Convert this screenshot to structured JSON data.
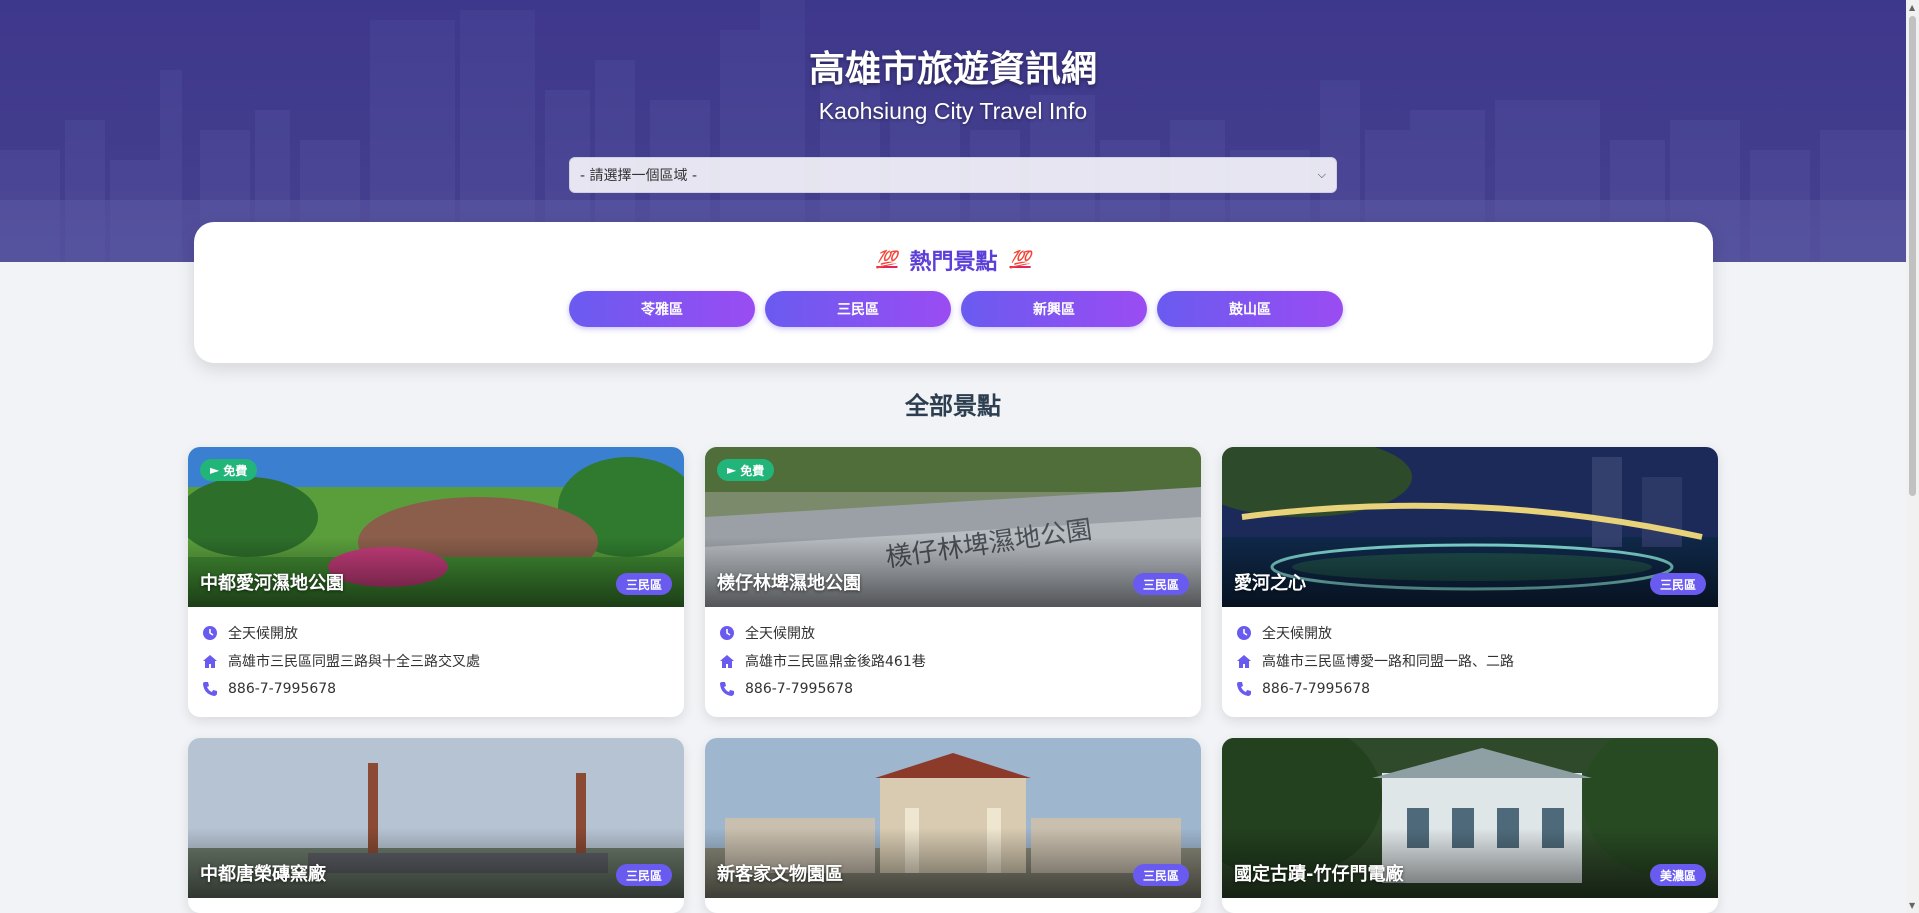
{
  "header": {
    "title": "高雄市旅遊資訊網",
    "subtitle": "Kaohsiung City Travel Info",
    "area_select": {
      "selected": "- 請選擇一個區域 -"
    }
  },
  "hot": {
    "title": "熱門景點",
    "emoji": "💯",
    "buttons": [
      "苓雅區",
      "三民區",
      "新興區",
      "鼓山區"
    ]
  },
  "section": {
    "title": "全部景點"
  },
  "cards": [
    {
      "name": "中都愛河濕地公園",
      "district": "三民區",
      "free": "免費",
      "hours": "全天候開放",
      "address": "高雄市三民區同盟三路與十全三路交叉處",
      "phone": "886-7-7995678"
    },
    {
      "name": "檨仔林埤濕地公園",
      "district": "三民區",
      "free": "免費",
      "hours": "全天候開放",
      "address": "高雄市三民區鼎金後路461巷",
      "phone": "886-7-7995678"
    },
    {
      "name": "愛河之心",
      "district": "三民區",
      "free": "",
      "hours": "全天候開放",
      "address": "高雄市三民區博愛一路和同盟一路、二路",
      "phone": "886-7-7995678"
    },
    {
      "name": "中都唐榮磚窯廠",
      "district": "三民區"
    },
    {
      "name": "新客家文物園區",
      "district": "三民區"
    },
    {
      "name": "國定古蹟-竹仔門電廠",
      "district": "美濃區"
    }
  ],
  "colors": {
    "accent": "#6a5bf0",
    "free_badge": "#22b57a"
  }
}
